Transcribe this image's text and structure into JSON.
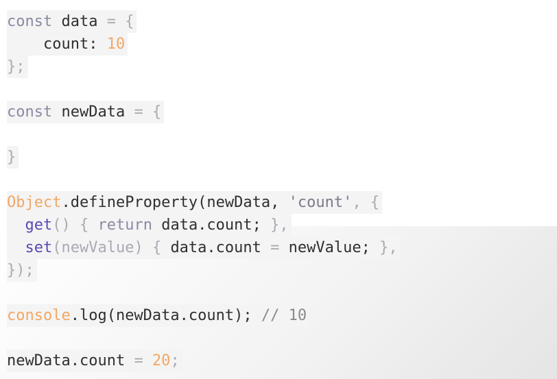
{
  "lines": [
    {
      "tokens": [
        {
          "text": "const ",
          "kind": "kw"
        },
        {
          "text": "data ",
          "kind": "ident"
        },
        {
          "text": "= {",
          "kind": "punct"
        }
      ]
    },
    {
      "tokens": [
        {
          "text": "    count: ",
          "kind": "ident"
        },
        {
          "text": "10",
          "kind": "num"
        }
      ]
    },
    {
      "tokens": [
        {
          "text": "};",
          "kind": "punct"
        }
      ]
    },
    {
      "tokens": [
        {
          "text": "const ",
          "kind": "kw"
        },
        {
          "text": "newData ",
          "kind": "ident"
        },
        {
          "text": "= {",
          "kind": "punct"
        }
      ]
    },
    {
      "tokens": [
        {
          "text": "}",
          "kind": "punct"
        }
      ]
    },
    {
      "tokens": [
        {
          "text": "Object",
          "kind": "obj"
        },
        {
          "text": ".defineProperty(newData, ",
          "kind": "ident"
        },
        {
          "text": "'count'",
          "kind": "str"
        },
        {
          "text": ", {",
          "kind": "punct"
        }
      ]
    },
    {
      "tokens": [
        {
          "text": "  ",
          "kind": "ident"
        },
        {
          "text": "get",
          "kind": "method"
        },
        {
          "text": "() { ",
          "kind": "punct"
        },
        {
          "text": "return ",
          "kind": "kw"
        },
        {
          "text": "data.count; ",
          "kind": "ident"
        },
        {
          "text": "},",
          "kind": "punct"
        }
      ]
    },
    {
      "tokens": [
        {
          "text": "  ",
          "kind": "ident"
        },
        {
          "text": "set",
          "kind": "method"
        },
        {
          "text": "(newValue) { ",
          "kind": "punct"
        },
        {
          "text": "data.count ",
          "kind": "ident"
        },
        {
          "text": "= ",
          "kind": "punct"
        },
        {
          "text": "newValue; ",
          "kind": "ident"
        },
        {
          "text": "},",
          "kind": "punct"
        }
      ]
    },
    {
      "tokens": [
        {
          "text": "});",
          "kind": "punct"
        }
      ]
    },
    {
      "tokens": [
        {
          "text": "console",
          "kind": "obj"
        },
        {
          "text": ".log(newData.count); ",
          "kind": "ident"
        },
        {
          "text": "// 10",
          "kind": "comment"
        }
      ]
    },
    {
      "tokens": [
        {
          "text": "newData.count ",
          "kind": "ident"
        },
        {
          "text": "= ",
          "kind": "punct"
        },
        {
          "text": "20",
          "kind": "num"
        },
        {
          "text": ";",
          "kind": "punct"
        }
      ]
    }
  ]
}
